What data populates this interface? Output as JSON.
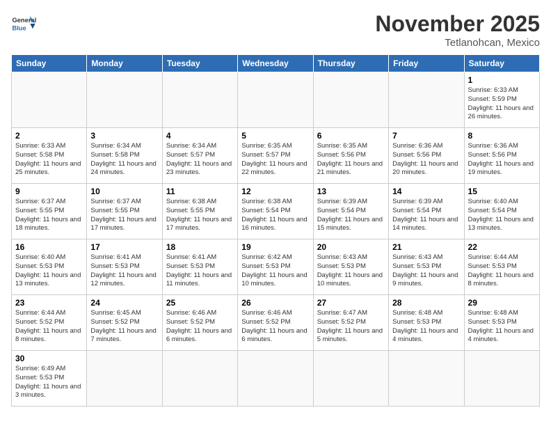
{
  "header": {
    "logo_general": "General",
    "logo_blue": "Blue",
    "month": "November 2025",
    "location": "Tetlanohcan, Mexico"
  },
  "days_of_week": [
    "Sunday",
    "Monday",
    "Tuesday",
    "Wednesday",
    "Thursday",
    "Friday",
    "Saturday"
  ],
  "weeks": [
    [
      {
        "date": "",
        "content": ""
      },
      {
        "date": "",
        "content": ""
      },
      {
        "date": "",
        "content": ""
      },
      {
        "date": "",
        "content": ""
      },
      {
        "date": "",
        "content": ""
      },
      {
        "date": "",
        "content": ""
      },
      {
        "date": "1",
        "content": "Sunrise: 6:33 AM\nSunset: 5:59 PM\nDaylight: 11 hours\nand 26 minutes."
      }
    ],
    [
      {
        "date": "2",
        "content": "Sunrise: 6:33 AM\nSunset: 5:58 PM\nDaylight: 11 hours\nand 25 minutes."
      },
      {
        "date": "3",
        "content": "Sunrise: 6:34 AM\nSunset: 5:58 PM\nDaylight: 11 hours\nand 24 minutes."
      },
      {
        "date": "4",
        "content": "Sunrise: 6:34 AM\nSunset: 5:57 PM\nDaylight: 11 hours\nand 23 minutes."
      },
      {
        "date": "5",
        "content": "Sunrise: 6:35 AM\nSunset: 5:57 PM\nDaylight: 11 hours\nand 22 minutes."
      },
      {
        "date": "6",
        "content": "Sunrise: 6:35 AM\nSunset: 5:56 PM\nDaylight: 11 hours\nand 21 minutes."
      },
      {
        "date": "7",
        "content": "Sunrise: 6:36 AM\nSunset: 5:56 PM\nDaylight: 11 hours\nand 20 minutes."
      },
      {
        "date": "8",
        "content": "Sunrise: 6:36 AM\nSunset: 5:56 PM\nDaylight: 11 hours\nand 19 minutes."
      }
    ],
    [
      {
        "date": "9",
        "content": "Sunrise: 6:37 AM\nSunset: 5:55 PM\nDaylight: 11 hours\nand 18 minutes."
      },
      {
        "date": "10",
        "content": "Sunrise: 6:37 AM\nSunset: 5:55 PM\nDaylight: 11 hours\nand 17 minutes."
      },
      {
        "date": "11",
        "content": "Sunrise: 6:38 AM\nSunset: 5:55 PM\nDaylight: 11 hours\nand 17 minutes."
      },
      {
        "date": "12",
        "content": "Sunrise: 6:38 AM\nSunset: 5:54 PM\nDaylight: 11 hours\nand 16 minutes."
      },
      {
        "date": "13",
        "content": "Sunrise: 6:39 AM\nSunset: 5:54 PM\nDaylight: 11 hours\nand 15 minutes."
      },
      {
        "date": "14",
        "content": "Sunrise: 6:39 AM\nSunset: 5:54 PM\nDaylight: 11 hours\nand 14 minutes."
      },
      {
        "date": "15",
        "content": "Sunrise: 6:40 AM\nSunset: 5:54 PM\nDaylight: 11 hours\nand 13 minutes."
      }
    ],
    [
      {
        "date": "16",
        "content": "Sunrise: 6:40 AM\nSunset: 5:53 PM\nDaylight: 11 hours\nand 13 minutes."
      },
      {
        "date": "17",
        "content": "Sunrise: 6:41 AM\nSunset: 5:53 PM\nDaylight: 11 hours\nand 12 minutes."
      },
      {
        "date": "18",
        "content": "Sunrise: 6:41 AM\nSunset: 5:53 PM\nDaylight: 11 hours\nand 11 minutes."
      },
      {
        "date": "19",
        "content": "Sunrise: 6:42 AM\nSunset: 5:53 PM\nDaylight: 11 hours\nand 10 minutes."
      },
      {
        "date": "20",
        "content": "Sunrise: 6:43 AM\nSunset: 5:53 PM\nDaylight: 11 hours\nand 10 minutes."
      },
      {
        "date": "21",
        "content": "Sunrise: 6:43 AM\nSunset: 5:53 PM\nDaylight: 11 hours\nand 9 minutes."
      },
      {
        "date": "22",
        "content": "Sunrise: 6:44 AM\nSunset: 5:53 PM\nDaylight: 11 hours\nand 8 minutes."
      }
    ],
    [
      {
        "date": "23",
        "content": "Sunrise: 6:44 AM\nSunset: 5:52 PM\nDaylight: 11 hours\nand 8 minutes."
      },
      {
        "date": "24",
        "content": "Sunrise: 6:45 AM\nSunset: 5:52 PM\nDaylight: 11 hours\nand 7 minutes."
      },
      {
        "date": "25",
        "content": "Sunrise: 6:46 AM\nSunset: 5:52 PM\nDaylight: 11 hours\nand 6 minutes."
      },
      {
        "date": "26",
        "content": "Sunrise: 6:46 AM\nSunset: 5:52 PM\nDaylight: 11 hours\nand 6 minutes."
      },
      {
        "date": "27",
        "content": "Sunrise: 6:47 AM\nSunset: 5:52 PM\nDaylight: 11 hours\nand 5 minutes."
      },
      {
        "date": "28",
        "content": "Sunrise: 6:48 AM\nSunset: 5:53 PM\nDaylight: 11 hours\nand 4 minutes."
      },
      {
        "date": "29",
        "content": "Sunrise: 6:48 AM\nSunset: 5:53 PM\nDaylight: 11 hours\nand 4 minutes."
      }
    ],
    [
      {
        "date": "30",
        "content": "Sunrise: 6:49 AM\nSunset: 5:53 PM\nDaylight: 11 hours\nand 3 minutes."
      },
      {
        "date": "",
        "content": ""
      },
      {
        "date": "",
        "content": ""
      },
      {
        "date": "",
        "content": ""
      },
      {
        "date": "",
        "content": ""
      },
      {
        "date": "",
        "content": ""
      },
      {
        "date": "",
        "content": ""
      }
    ]
  ]
}
